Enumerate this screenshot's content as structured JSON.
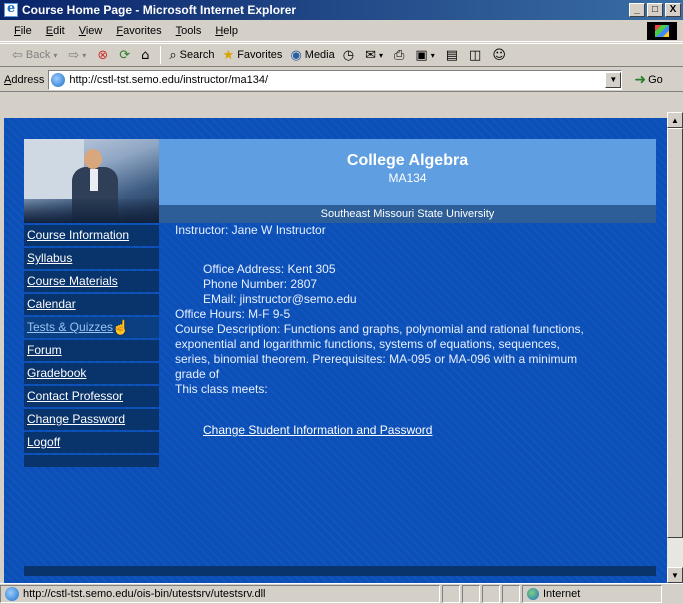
{
  "window": {
    "title": "Course Home Page - Microsoft Internet Explorer",
    "minimize": "_",
    "maximize": "□",
    "close": "X"
  },
  "menu": {
    "items": [
      "File",
      "Edit",
      "View",
      "Favorites",
      "Tools",
      "Help"
    ]
  },
  "toolbar": {
    "back": "Back",
    "search": "Search",
    "favorites": "Favorites",
    "media": "Media"
  },
  "address": {
    "label": "Address",
    "url": "http://cstl-tst.semo.edu/instructor/ma134/",
    "go": "Go"
  },
  "page": {
    "course_title": "College Algebra",
    "course_code": "MA134",
    "university": "Southeast Missouri State University",
    "nav": [
      "Course Information",
      "Syllabus",
      "Course Materials",
      "Calendar",
      "Tests & Quizzes",
      "Forum",
      "Gradebook",
      "Contact Professor",
      "Change Password",
      "Logoff"
    ],
    "instructor": "Instructor: Jane W Instructor",
    "office_address": "Office Address: Kent 305",
    "phone": "Phone Number: 2807",
    "email": "EMail: jinstructor@semo.edu",
    "office_hours": "Office Hours: M-F 9-5",
    "description": "Course Description: Functions and graphs, polynomial and rational functions, exponential and logarithmic functions, systems of equations, sequences, series, binomial theorem. Prerequisites: MA-095 or MA-096 with a minimum grade of",
    "meets": "This class meets:",
    "change_link": "Change Student Information and Password"
  },
  "status": {
    "text": "http://cstl-tst.semo.edu/ois-bin/utestsrv/utestsrv.dll",
    "zone": "Internet"
  },
  "colors": {
    "page_bg": "#0b4fb8",
    "nav_bg": "#08336b",
    "banner": "#5f9ee0",
    "univ_bar": "#2d5e98"
  }
}
